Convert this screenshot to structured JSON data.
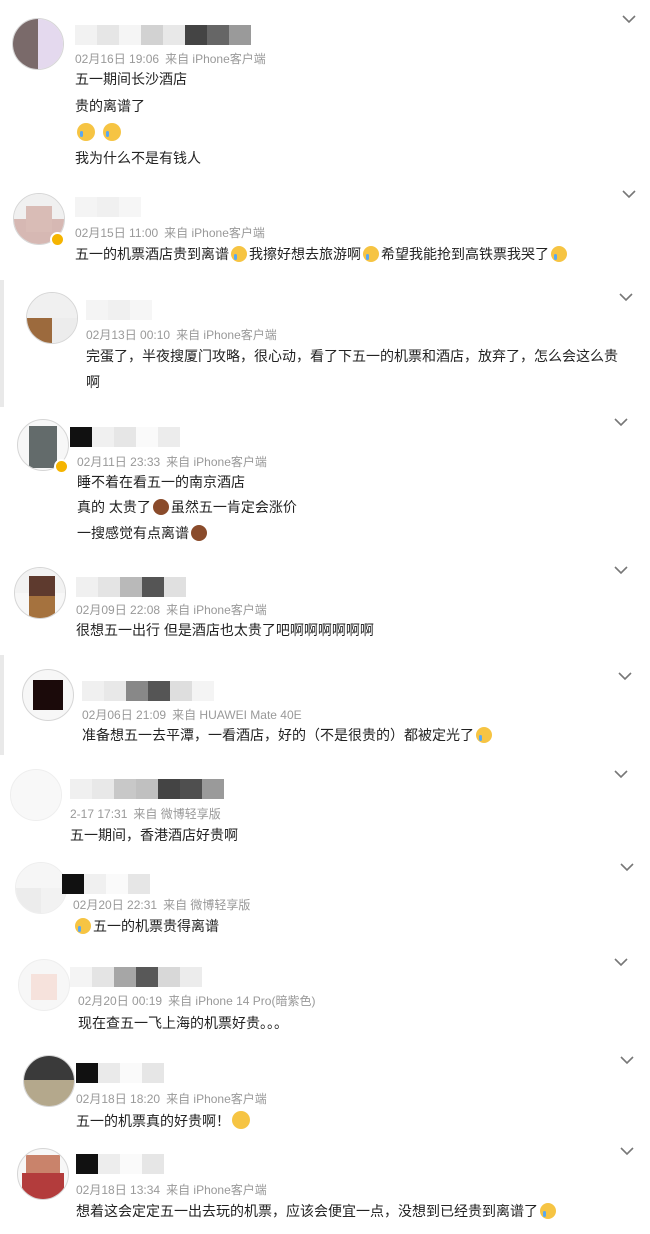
{
  "colors": {
    "meta": "#999999",
    "text": "#222222",
    "badge": "#f5b400",
    "divider": "#e9e9e9"
  },
  "comments": [
    {
      "date": "02月16日 19:06",
      "source": "来自 iPhone客户端",
      "lines": [
        "五一期间长沙酒店",
        "贵的离谱了",
        "",
        "我为什么不是有钱人"
      ],
      "emoji_icons": [
        "loudly-crying-face-icon",
        "loudly-crying-face-icon"
      ]
    },
    {
      "date": "02月15日 11:00",
      "source": "来自 iPhone客户端",
      "segments": [
        "五一的机票酒店贵到离谱",
        "我擦好想去旅游啊",
        "希望我能抢到高铁票我哭了"
      ],
      "emoji_icons": [
        "crying-emoji-icon",
        "crying-emoji-icon",
        "crying-emoji-icon"
      ]
    },
    {
      "date": "02月13日 00:10",
      "source": "来自 iPhone客户端",
      "lines": [
        "完蛋了，半夜搜厦门攻略，很心动，看了下五一的机票和酒店，放弃了，怎么会这么贵",
        "啊"
      ]
    },
    {
      "date": "02月11日 23:33",
      "source": "来自 iPhone客户端",
      "lines": [
        "睡不着在看五一的南京酒店",
        "真的 太贵了",
        "虽然五一肯定会涨价",
        "一搜感觉有点离谱"
      ],
      "emoji_icons": [
        "see-no-evil-monkey-icon",
        "see-no-evil-monkey-icon"
      ]
    },
    {
      "date": "02月09日 22:08",
      "source": "来自 iPhone客户端",
      "lines": [
        "很想五一出行 但是酒店也太贵了吧啊啊啊啊啊啊"
      ]
    },
    {
      "date": "02月06日 21:09",
      "source": "来自 HUAWEI Mate 40E",
      "lines": [
        "准备想五一去平潭，一看酒店，好的（不是很贵的）都被定光了"
      ],
      "emoji_icons": [
        "sweat-smile-face-icon"
      ]
    },
    {
      "date": "2-17 17:31",
      "source": "来自 微博轻享版",
      "lines": [
        "五一期间，香港酒店好贵啊"
      ]
    },
    {
      "date": "02月20日 22:31",
      "source": "来自 微博轻享版",
      "lines": [
        "五一的机票贵得离谱"
      ],
      "emoji_icons": [
        "loudly-crying-face-icon"
      ]
    },
    {
      "date": "02月20日 00:19",
      "source": "来自 iPhone 14 Pro(暗紫色)",
      "lines": [
        "现在查五一飞上海的机票好贵。。。"
      ]
    },
    {
      "date": "02月18日 18:20",
      "source": "来自 iPhone客户端",
      "lines": [
        "五一的机票真的好贵啊！"
      ],
      "emoji_icons": [
        "pleading-face-icon"
      ]
    },
    {
      "date": "02月18日 13:34",
      "source": "来自 iPhone客户端",
      "lines": [
        "想着这会定定五一出去玩的机票，应该会便宜一点，没想到已经贵到离谱了"
      ],
      "emoji_icons": [
        "sweat-smile-face-icon"
      ]
    }
  ]
}
